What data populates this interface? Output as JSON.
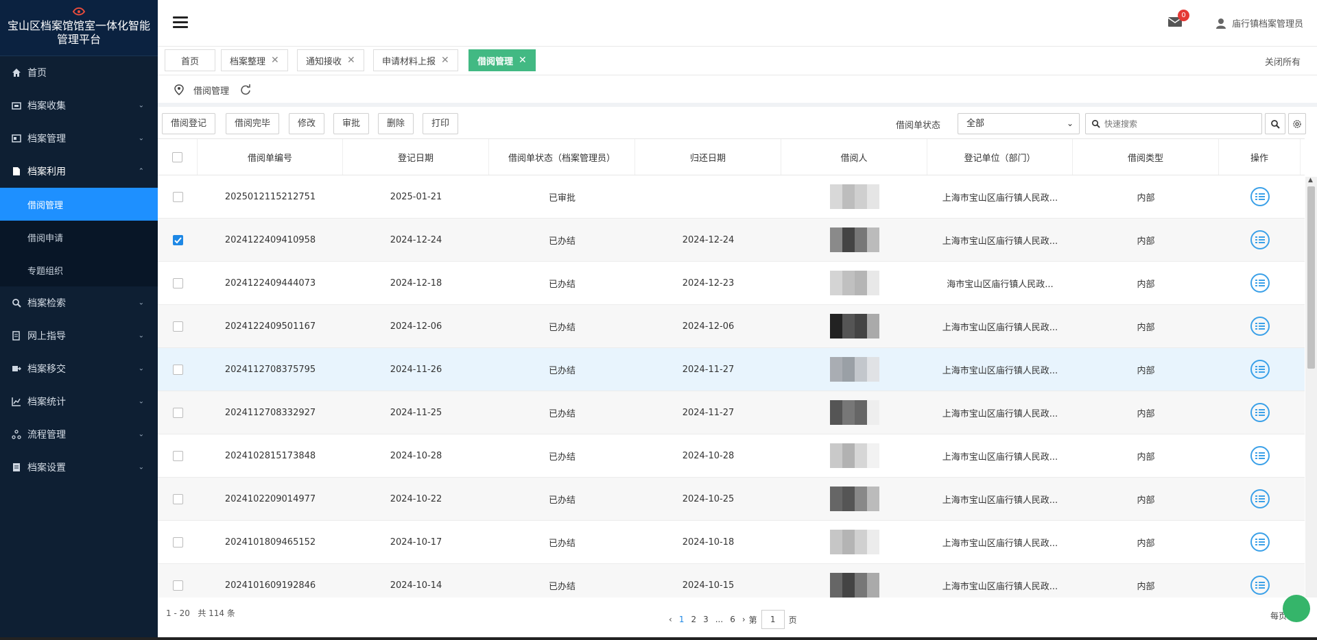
{
  "app": {
    "title": "宝山区档案馆馆室一体化智能管理平台"
  },
  "sidebar": {
    "items": [
      {
        "label": "首页",
        "icon": "home-icon"
      },
      {
        "label": "档案收集",
        "icon": "collect-icon"
      },
      {
        "label": "档案管理",
        "icon": "manage-icon"
      },
      {
        "label": "档案利用",
        "icon": "use-icon",
        "expanded": true,
        "children": [
          {
            "label": "借阅管理",
            "active": true
          },
          {
            "label": "借阅申请"
          },
          {
            "label": "专题组织"
          }
        ]
      },
      {
        "label": "档案检索",
        "icon": "search-icon"
      },
      {
        "label": "网上指导",
        "icon": "guide-icon"
      },
      {
        "label": "档案移交",
        "icon": "transfer-icon"
      },
      {
        "label": "档案统计",
        "icon": "chart-icon"
      },
      {
        "label": "流程管理",
        "icon": "flow-icon"
      },
      {
        "label": "档案设置",
        "icon": "settings-icon"
      }
    ]
  },
  "header": {
    "mail_count": "0",
    "user": "庙行镇档案管理员"
  },
  "tabs": [
    {
      "label": "首页",
      "closable": false
    },
    {
      "label": "档案整理",
      "closable": true
    },
    {
      "label": "通知接收",
      "closable": true
    },
    {
      "label": "申请材料上报",
      "closable": true
    },
    {
      "label": "借阅管理",
      "closable": true,
      "active": true
    }
  ],
  "close_all": "关闭所有",
  "breadcrumb": {
    "label": "借阅管理"
  },
  "toolbar": {
    "buttons": [
      "借阅登记",
      "借阅完毕",
      "修改",
      "审批",
      "删除",
      "打印"
    ],
    "status_label": "借阅单状态",
    "status_value": "全部",
    "search_placeholder": "快速搜索"
  },
  "table": {
    "columns": [
      "借阅单编号",
      "登记日期",
      "借阅单状态（档案管理员）",
      "归还日期",
      "借阅人",
      "登记单位（部门）",
      "借阅类型",
      "操作"
    ],
    "rows": [
      {
        "id": "2025012115212751",
        "date": "2025-01-21",
        "status": "已审批",
        "return": "",
        "unit": "上海市宝山区庙行镇人民政...",
        "type": "内部",
        "checked": false
      },
      {
        "id": "2024122409410958",
        "date": "2024-12-24",
        "status": "已办结",
        "return": "2024-12-24",
        "unit": "上海市宝山区庙行镇人民政...",
        "type": "内部",
        "checked": true
      },
      {
        "id": "2024122409444073",
        "date": "2024-12-18",
        "status": "已办结",
        "return": "2024-12-23",
        "unit": "海市宝山区庙行镇人民政...",
        "type": "内部",
        "checked": false
      },
      {
        "id": "2024122409501167",
        "date": "2024-12-06",
        "status": "已办结",
        "return": "2024-12-06",
        "unit": "上海市宝山区庙行镇人民政...",
        "type": "内部",
        "checked": false
      },
      {
        "id": "2024112708375795",
        "date": "2024-11-26",
        "status": "已办结",
        "return": "2024-11-27",
        "unit": "上海市宝山区庙行镇人民政...",
        "type": "内部",
        "checked": false
      },
      {
        "id": "2024112708332927",
        "date": "2024-11-25",
        "status": "已办结",
        "return": "2024-11-27",
        "unit": "上海市宝山区庙行镇人民政...",
        "type": "内部",
        "checked": false
      },
      {
        "id": "2024102815173848",
        "date": "2024-10-28",
        "status": "已办结",
        "return": "2024-10-28",
        "unit": "上海市宝山区庙行镇人民政...",
        "type": "内部",
        "checked": false
      },
      {
        "id": "2024102209014977",
        "date": "2024-10-22",
        "status": "已办结",
        "return": "2024-10-25",
        "unit": "上海市宝山区庙行镇人民政...",
        "type": "内部",
        "checked": false
      },
      {
        "id": "2024101809465152",
        "date": "2024-10-17",
        "status": "已办结",
        "return": "2024-10-18",
        "unit": "上海市宝山区庙行镇人民政...",
        "type": "内部",
        "checked": false
      },
      {
        "id": "2024101609192846",
        "date": "2024-10-14",
        "status": "已办结",
        "return": "2024-10-15",
        "unit": "上海市宝山区庙行镇人民政...",
        "type": "内部",
        "checked": false
      }
    ]
  },
  "pager": {
    "range": "1 - 20",
    "total": "共 114 条",
    "pages": [
      "1",
      "2",
      "3",
      "...",
      "6"
    ],
    "goto_prefix": "第",
    "goto_value": "1",
    "goto_suffix": "页",
    "per_page": "每页"
  },
  "colors": {
    "accent": "#1e90ff",
    "tab_active": "#42b983",
    "sidebar": "#0e1f33"
  }
}
